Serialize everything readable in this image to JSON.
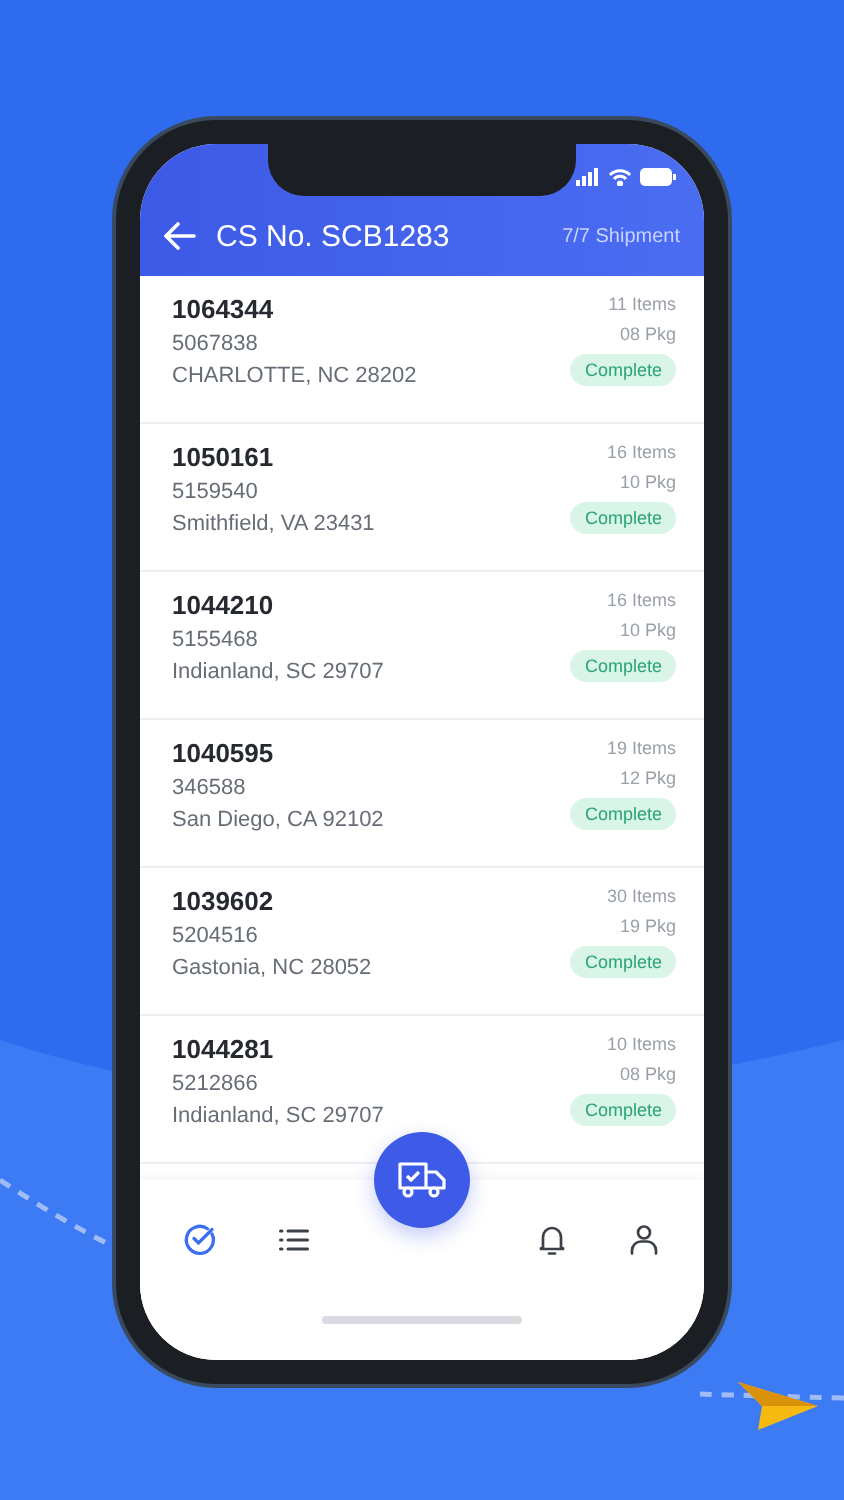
{
  "header": {
    "title": "CS No. SCB1283",
    "count": "7/7 Shipment"
  },
  "shipments": [
    {
      "number": "1064344",
      "code": "5067838",
      "address": "CHARLOTTE, NC  28202",
      "items": "11 Items",
      "packages": "08 Pkg",
      "status": "Complete"
    },
    {
      "number": "1050161",
      "code": "5159540",
      "address": "Smithfield, VA 23431",
      "items": "16 Items",
      "packages": "10 Pkg",
      "status": "Complete"
    },
    {
      "number": "1044210",
      "code": "5155468",
      "address": "Indianland, SC 29707",
      "items": "16 Items",
      "packages": "10 Pkg",
      "status": "Complete"
    },
    {
      "number": "1040595",
      "code": "346588",
      "address": "San Diego, CA 92102",
      "items": "19 Items",
      "packages": "12 Pkg",
      "status": "Complete"
    },
    {
      "number": "1039602",
      "code": "5204516",
      "address": "Gastonia, NC 28052",
      "items": "30 Items",
      "packages": "19 Pkg",
      "status": "Complete"
    },
    {
      "number": "1044281",
      "code": "5212866",
      "address": "Indianland, SC 29707",
      "items": "10 Items",
      "packages": "08 Pkg",
      "status": "Complete"
    }
  ],
  "nav": [
    {
      "selected": true
    },
    {
      "selected": false
    },
    {
      "selected": false
    },
    {
      "selected": false
    }
  ]
}
